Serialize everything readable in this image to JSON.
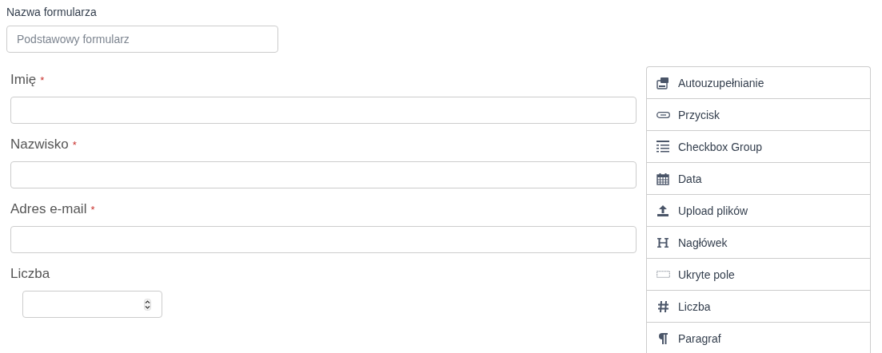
{
  "form_name": {
    "label": "Nazwa formularza",
    "placeholder": "Podstawowy formularz"
  },
  "fields": [
    {
      "kind": "text",
      "label": "Imię",
      "required_mark": "*"
    },
    {
      "kind": "text",
      "label": "Nazwisko",
      "required_mark": "*"
    },
    {
      "kind": "text",
      "label": "Adres e-mail",
      "required_mark": "*"
    },
    {
      "kind": "number",
      "label": "Liczba"
    }
  ],
  "palette": [
    {
      "kind": "autocomplete",
      "label": "Autouzupełnianie"
    },
    {
      "kind": "button",
      "label": "Przycisk"
    },
    {
      "kind": "checkbox-group",
      "label": "Checkbox Group"
    },
    {
      "kind": "date",
      "label": "Data"
    },
    {
      "kind": "file",
      "label": "Upload plików"
    },
    {
      "kind": "header",
      "label": "Nagłówek"
    },
    {
      "kind": "hidden",
      "label": "Ukryte pole"
    },
    {
      "kind": "number",
      "label": "Liczba"
    },
    {
      "kind": "paragraph",
      "label": "Paragraf"
    }
  ]
}
